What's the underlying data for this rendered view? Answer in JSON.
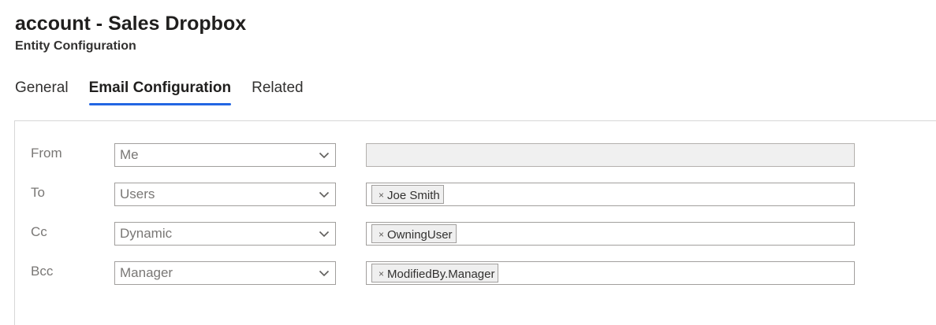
{
  "header": {
    "title": "account - Sales Dropbox",
    "subtitle": "Entity Configuration"
  },
  "tabs": [
    {
      "label": "General",
      "active": false
    },
    {
      "label": "Email Configuration",
      "active": true
    },
    {
      "label": "Related",
      "active": false
    }
  ],
  "colors": {
    "accent": "#2266e3",
    "label_text": "#797775",
    "disabled_field": "#f0f0f0",
    "chip_background": "#efefef"
  },
  "email_config": {
    "rows": [
      {
        "label": "From",
        "select_value": "Me",
        "recipient": "",
        "recipient_disabled": true
      },
      {
        "label": "To",
        "select_value": "Users",
        "recipient": "Joe Smith",
        "recipient_disabled": false
      },
      {
        "label": "Cc",
        "select_value": "Dynamic",
        "recipient": "OwningUser",
        "recipient_disabled": false
      },
      {
        "label": "Bcc",
        "select_value": "Manager",
        "recipient": "ModifiedBy.Manager",
        "recipient_disabled": false
      }
    ],
    "chip_remove_glyph": "×",
    "select_icon": "chevron-down-icon"
  }
}
